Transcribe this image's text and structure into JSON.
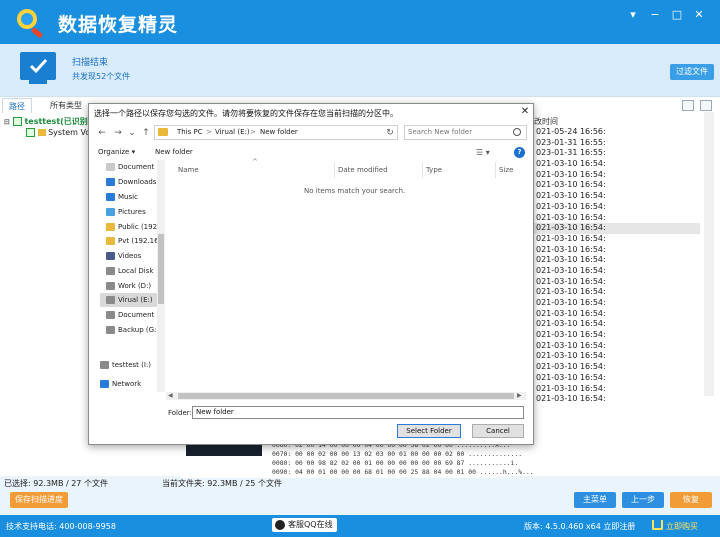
{
  "app": {
    "title": "数据恢复精灵",
    "accent_color": "#1a8fe0"
  },
  "window_controls": [
    "down-icon",
    "minimize-icon",
    "maximize-icon",
    "close-icon"
  ],
  "banner": {
    "title": "扫描结束",
    "subtitle": "共发现52个文件",
    "filter_button": "过滤文件"
  },
  "tabs": {
    "path": "路径",
    "type": "所有类型"
  },
  "tree": {
    "row1": "testtest(已识别",
    "row2": "System Vo"
  },
  "time_column": {
    "header": "改时间",
    "rows": [
      "021-05-24 16:56:",
      "023-01-31 16:55:",
      "023-01-31 16:55:",
      "021-03-10 16:54:",
      "021-03-10 16:54:",
      "021-03-10 16:54:",
      "021-03-10 16:54:",
      "021-03-10 16:54:",
      "021-03-10 16:54:",
      "021-03-10 16:54:",
      "021-03-10 16:54:",
      "021-03-10 16:54:",
      "021-03-10 16:54:",
      "021-03-10 16:54:",
      "021-03-10 16:54:",
      "021-03-10 16:54:",
      "021-03-10 16:54:",
      "021-03-10 16:54:",
      "021-03-10 16:54:",
      "021-03-10 16:54:",
      "021-03-10 16:54:",
      "021-03-10 16:54:",
      "021-03-10 16:54:",
      "021-03-10 16:54:",
      "021-03-10 16:54:",
      "021-03-10 16:54:"
    ],
    "selected_index": 9
  },
  "hex_rows": [
    "0060: 02 00 14 00 00 00 04 00 00 00 58 02 00 00 ..........X...",
    "0070: 00 00 02 00 00 13 02 03 00 01 00 00 00 02 00 ..............",
    "0080: 00 00 98 82 02 00 01 00 00 00 00 00 00 69 87 ...........i.",
    "0090: 04 00 01 00 00 00 68 01 00 00 25 88 04 00 01 00 ......h...%..."
  ],
  "dialog": {
    "title": "选择一个路径以保存您勾选的文件。请勿将要恢复的文件保存在您当前扫描的分区中。",
    "close": "✕",
    "breadcrumb": [
      "This PC",
      ">",
      "Virual (E:)",
      ">",
      "New folder"
    ],
    "search_placeholder": "Search New folder",
    "organize": "Organize ▾",
    "new_folder": "New folder",
    "view_button": "☰ ▾",
    "help": "?",
    "nav_items": [
      {
        "label": "Document",
        "icon": "documents-icon",
        "color": "#c9c9c9"
      },
      {
        "label": "Downloads",
        "icon": "downloads-icon",
        "color": "#2a7ad8"
      },
      {
        "label": "Music",
        "icon": "music-icon",
        "color": "#2a7ad8"
      },
      {
        "label": "Pictures",
        "icon": "pictures-icon",
        "color": "#4aa0e0"
      },
      {
        "label": "Public (192",
        "icon": "network-drive-icon",
        "color": "#e8b93c"
      },
      {
        "label": "Pvt (192.16",
        "icon": "network-drive-icon",
        "color": "#e8b93c"
      },
      {
        "label": "Videos",
        "icon": "videos-icon",
        "color": "#4a5a8a"
      },
      {
        "label": "Local Disk",
        "icon": "disk-icon",
        "color": "#8a8a8a"
      },
      {
        "label": "Work (D:)",
        "icon": "disk-icon",
        "color": "#8a8a8a"
      },
      {
        "label": "Virual (E:)",
        "icon": "disk-icon",
        "color": "#8a8a8a"
      },
      {
        "label": "Document",
        "icon": "disk-icon",
        "color": "#8a8a8a"
      },
      {
        "label": "Backup (G:",
        "icon": "disk-icon",
        "color": "#8a8a8a"
      },
      {
        "label": "testtest (I:)",
        "icon": "disk-icon",
        "color": "#8a8a8a"
      },
      {
        "label": "testtest (I:)",
        "icon": "disk-icon",
        "color": "#8a8a8a"
      },
      {
        "label": "Network",
        "icon": "network-icon",
        "color": "#2a7ad8"
      }
    ],
    "selected_nav_index": 9,
    "columns": [
      "Name",
      "Date modified",
      "Type",
      "Size"
    ],
    "empty_message": "No items match your search.",
    "folder_label": "Folder:",
    "folder_value": "New folder",
    "select_folder": "Select Folder",
    "cancel": "Cancel"
  },
  "footer": {
    "selected": "已选择: 92.3MB / 27 个文件",
    "current_folder": "当前文件夹: 92.3MB / 25 个文件",
    "save_progress": "保存扫描进度",
    "main_menu": "主菜单",
    "prev": "上一步",
    "recover": "恢复"
  },
  "statusbar": {
    "support": "技术支持电话: 400-008-9958",
    "qq": "客服QQ在线",
    "version": "版本: 4.5.0.460 x64   立即注册",
    "buy": "立即购买"
  }
}
